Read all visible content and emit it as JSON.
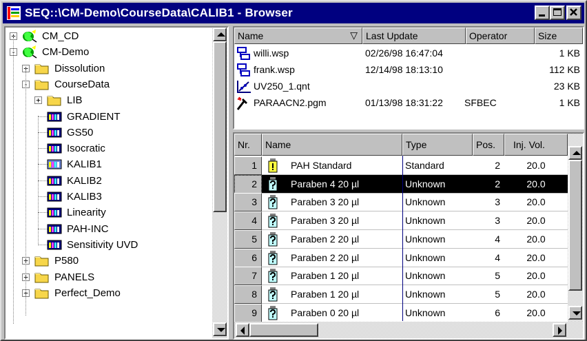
{
  "window": {
    "title": "SEQ::\\CM-Demo\\CourseData\\CALIB1 - Browser",
    "buttons": [
      "minimize",
      "maximize",
      "close"
    ]
  },
  "tree": {
    "items": [
      {
        "label": "CM_CD",
        "icon": "globe-icon",
        "toggle": "+"
      },
      {
        "label": "CM-Demo",
        "icon": "globe-icon",
        "toggle": "-"
      },
      {
        "label": "Dissolution",
        "icon": "folder-icon",
        "toggle": "+"
      },
      {
        "label": "CourseData",
        "icon": "folder-open-icon",
        "toggle": "-"
      },
      {
        "label": "LIB",
        "icon": "folder-icon",
        "toggle": "+"
      },
      {
        "label": "GRADIENT",
        "icon": "sequence-icon"
      },
      {
        "label": "GS50",
        "icon": "sequence-icon"
      },
      {
        "label": "Isocratic",
        "icon": "sequence-icon"
      },
      {
        "label": "KALIB1",
        "icon": "sequence-open-icon"
      },
      {
        "label": "KALIB2",
        "icon": "sequence-icon"
      },
      {
        "label": "KALIB3",
        "icon": "sequence-icon"
      },
      {
        "label": "Linearity",
        "icon": "sequence-icon"
      },
      {
        "label": "PAH-INC",
        "icon": "sequence-icon"
      },
      {
        "label": "Sensitivity UVD",
        "icon": "sequence-icon"
      },
      {
        "label": "P580",
        "icon": "folder-icon",
        "toggle": "+"
      },
      {
        "label": "PANELS",
        "icon": "folder-icon",
        "toggle": "+"
      },
      {
        "label": "Perfect_Demo",
        "icon": "folder-icon",
        "toggle": "+"
      }
    ]
  },
  "files": {
    "headers": {
      "name": "Name",
      "sort_indicator": "▽",
      "last_update": "Last Update",
      "operator": "Operator",
      "size": "Size"
    },
    "rows": [
      {
        "icon": "sample-list-icon",
        "name": "willi.wsp",
        "last_update": "02/26/98 16:47:04",
        "operator": "",
        "size": "1 KB"
      },
      {
        "icon": "sample-list-icon",
        "name": "frank.wsp",
        "last_update": "12/14/98 18:13:10",
        "operator": "",
        "size": "112 KB"
      },
      {
        "icon": "quantitation-icon",
        "name": "UV250_1.qnt",
        "last_update": "",
        "operator": "",
        "size": "23 KB"
      },
      {
        "icon": "program-icon",
        "name": "PARAACN2.pgm",
        "last_update": "01/13/98 18:31:22",
        "operator": "SFBEC",
        "size": "1 KB"
      }
    ]
  },
  "sequence": {
    "headers": {
      "nr": "Nr.",
      "name": "Name",
      "type": "Type",
      "pos": "Pos.",
      "inj_vol": "Inj. Vol."
    },
    "rows": [
      {
        "nr": "1",
        "icon": "vial-standard-icon",
        "name": "PAH Standard",
        "type": "Standard",
        "pos": "2",
        "inj_vol": "20.0"
      },
      {
        "nr": "2",
        "icon": "vial-unknown-icon",
        "name": "Paraben 4 20 µl",
        "type": "Unknown",
        "pos": "2",
        "inj_vol": "20.0",
        "selected": true
      },
      {
        "nr": "3",
        "icon": "vial-unknown-icon",
        "name": "Paraben 3 20 µl",
        "type": "Unknown",
        "pos": "3",
        "inj_vol": "20.0"
      },
      {
        "nr": "4",
        "icon": "vial-unknown-icon",
        "name": "Paraben 3 20 µl",
        "type": "Unknown",
        "pos": "3",
        "inj_vol": "20.0"
      },
      {
        "nr": "5",
        "icon": "vial-unknown-icon",
        "name": "Paraben 2 20 µl",
        "type": "Unknown",
        "pos": "4",
        "inj_vol": "20.0"
      },
      {
        "nr": "6",
        "icon": "vial-unknown-icon",
        "name": "Paraben 2 20 µl",
        "type": "Unknown",
        "pos": "4",
        "inj_vol": "20.0"
      },
      {
        "nr": "7",
        "icon": "vial-unknown-icon",
        "name": "Paraben 1 20 µl",
        "type": "Unknown",
        "pos": "5",
        "inj_vol": "20.0"
      },
      {
        "nr": "8",
        "icon": "vial-unknown-icon",
        "name": "Paraben 1 20 µl",
        "type": "Unknown",
        "pos": "5",
        "inj_vol": "20.0"
      },
      {
        "nr": "9",
        "icon": "vial-unknown-icon",
        "name": "Paraben 0 20 µl",
        "type": "Unknown",
        "pos": "6",
        "inj_vol": "20.0"
      }
    ]
  },
  "colors": {
    "titlebar": "#000080",
    "face": "#c0c0c0",
    "selection": "#000000",
    "type_column_line": "#000080"
  }
}
